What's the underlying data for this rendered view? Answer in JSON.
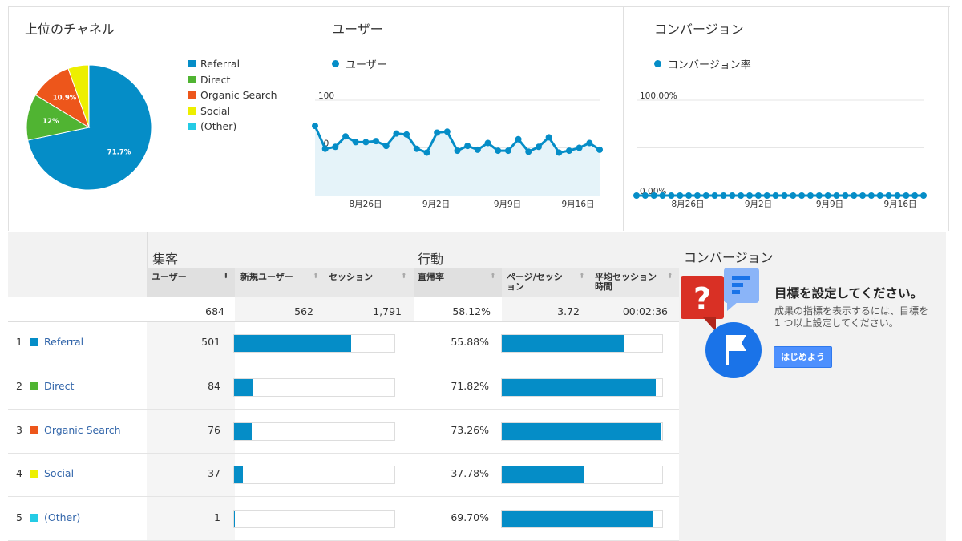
{
  "colors": {
    "referral": "#058dc7",
    "direct": "#50b432",
    "organic": "#ed561b",
    "social": "#edef00",
    "other": "#24cbe5",
    "accent": "#058dc7"
  },
  "channels_card": {
    "title": "上位のチャネル",
    "legend": [
      "Referral",
      "Direct",
      "Organic Search",
      "Social",
      "(Other)"
    ]
  },
  "users_card": {
    "title": "ユーザー",
    "series_label": "ユーザー",
    "y_ticks": [
      "100",
      "50"
    ],
    "x_ticks": [
      "8月26日",
      "9月2日",
      "9月9日",
      "9月16日"
    ]
  },
  "conversion_card": {
    "title": "コンバージョン",
    "series_label": "コンバージョン率",
    "y_ticks": [
      "100.00%",
      "0.00%"
    ],
    "x_ticks": [
      "8月26日",
      "9月2日",
      "9月9日",
      "9月16日"
    ]
  },
  "chart_data": [
    {
      "type": "pie",
      "title": "上位のチャネル",
      "categories": [
        "Referral",
        "Direct",
        "Organic Search",
        "Social",
        "(Other)"
      ],
      "values": [
        71.7,
        12,
        10.9,
        5.3,
        0.1
      ],
      "data_labels": [
        "71.7%",
        "12%",
        "10.9%",
        "",
        ""
      ]
    },
    {
      "type": "area",
      "title": "ユーザー",
      "series": [
        {
          "name": "ユーザー",
          "values": [
            73,
            49,
            51,
            62,
            56,
            56,
            57,
            52,
            65,
            64,
            49,
            45,
            66,
            67,
            47,
            52,
            48,
            55,
            47,
            47,
            59,
            46,
            51,
            61,
            45,
            47,
            50,
            55,
            48
          ]
        }
      ],
      "ylim": [
        0,
        100
      ]
    },
    {
      "type": "line",
      "title": "コンバージョン",
      "series": [
        {
          "name": "コンバージョン率",
          "values": [
            0,
            0,
            0,
            0,
            0,
            0,
            0,
            0,
            0,
            0,
            0,
            0,
            0,
            0,
            0,
            0,
            0,
            0,
            0,
            0,
            0,
            0,
            0,
            0,
            0,
            0,
            0,
            0,
            0,
            0,
            0,
            0,
            0,
            0
          ]
        }
      ],
      "ylim": [
        0,
        100
      ]
    }
  ],
  "table": {
    "group_acquisition": "集客",
    "group_behavior": "行動",
    "columns": {
      "users": "ユーザー",
      "new_users": "新規ユーザー",
      "sessions": "セッション",
      "bounce": "直帰率",
      "pages_line1": "ページ/セッシ",
      "pages_line2": "ョン",
      "duration_line1": "平均セッション",
      "duration_line2": "時間"
    },
    "totals": {
      "users": "684",
      "new_users": "562",
      "sessions": "1,791",
      "bounce": "58.12%",
      "pages": "3.72",
      "duration": "00:02:36"
    },
    "rows": [
      {
        "num": "1",
        "label": "Referral",
        "users": "501",
        "users_share": 0.73,
        "bounce": "55.88%",
        "bounce_share": 0.7588
      },
      {
        "num": "2",
        "label": "Direct",
        "users": "84",
        "users_share": 0.12,
        "bounce": "71.82%",
        "bounce_share": 0.9582
      },
      {
        "num": "3",
        "label": "Organic Search",
        "users": "76",
        "users_share": 0.11,
        "bounce": "73.26%",
        "bounce_share": 0.9926
      },
      {
        "num": "4",
        "label": "Social",
        "users": "37",
        "users_share": 0.054,
        "bounce": "37.78%",
        "bounce_share": 0.5137
      },
      {
        "num": "5",
        "label": "(Other)",
        "users": "1",
        "users_share": 0.002,
        "bounce": "69.70%",
        "bounce_share": 0.9448
      }
    ]
  },
  "conversion_panel": {
    "title": "コンバージョン",
    "heading": "目標を設定してください。",
    "text": "成果の指標を表示するには、目標を 1 つ以上設定してください。",
    "button": "はじめよう",
    "icons": [
      "question-mark-icon",
      "document-lines-icon",
      "flag-icon"
    ]
  }
}
